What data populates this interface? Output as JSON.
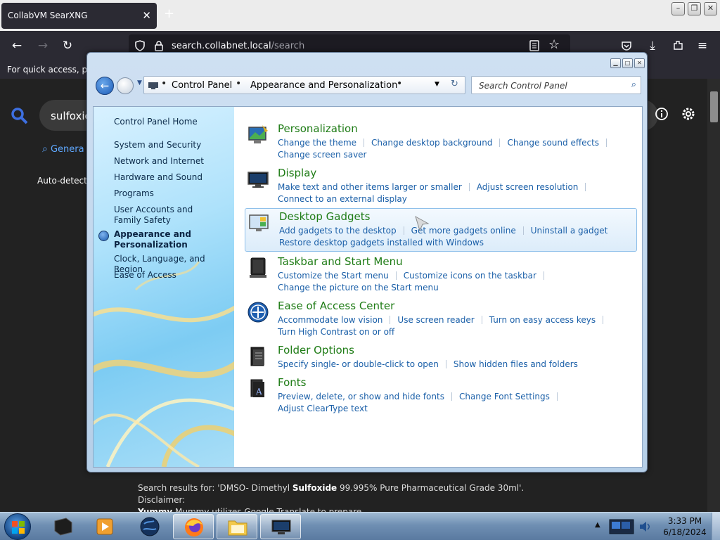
{
  "browser": {
    "tab_title": "CollabVM SearXNG",
    "tab_close": "✕",
    "new_tab": "+",
    "url_domain": "search.collabnet.local",
    "url_path": "/search",
    "bookmarks_text": "For quick access, plac",
    "search_query": "sulfoxic",
    "tab_general": "Genera",
    "autodetect": "Auto-detect",
    "snippet_prefix": "Search results for: 'DMSO- Dimethyl ",
    "snippet_bold1": "Sulfoxide",
    "snippet_mid": " 99.995% Pure Pharmaceutical Grade 30ml'. Disclaimer:",
    "snippet_bold2": "Yummy",
    "snippet_end": " Mummy utilizes Google Translate to prepare ..."
  },
  "control_panel": {
    "breadcrumb": [
      "Control Panel",
      "Appearance and Personalization"
    ],
    "search_placeholder": "Search Control Panel",
    "nav": {
      "home": "Control Panel Home",
      "items": [
        "System and Security",
        "Network and Internet",
        "Hardware and Sound",
        "Programs",
        "User Accounts and Family Safety",
        "Appearance and Personalization",
        "Clock, Language, and Region",
        "Ease of Access"
      ],
      "current_index": 5
    },
    "categories": [
      {
        "title": "Personalization",
        "icon": "personalization-icon",
        "links": [
          "Change the theme",
          "Change desktop background",
          "Change sound effects",
          "Change screen saver"
        ]
      },
      {
        "title": "Display",
        "icon": "display-icon",
        "links": [
          "Make text and other items larger or smaller",
          "Adjust screen resolution",
          "Connect to an external display"
        ]
      },
      {
        "title": "Desktop Gadgets",
        "icon": "desktop-gadgets-icon",
        "links": [
          "Add gadgets to the desktop",
          "Get more gadgets online",
          "Uninstall a gadget",
          "Restore desktop gadgets installed with Windows"
        ]
      },
      {
        "title": "Taskbar and Start Menu",
        "icon": "taskbar-icon",
        "links": [
          "Customize the Start menu",
          "Customize icons on the taskbar",
          "Change the picture on the Start menu"
        ]
      },
      {
        "title": "Ease of Access Center",
        "icon": "ease-of-access-icon",
        "links": [
          "Accommodate low vision",
          "Use screen reader",
          "Turn on easy access keys",
          "Turn High Contrast on or off"
        ]
      },
      {
        "title": "Folder Options",
        "icon": "folder-options-icon",
        "links": [
          "Specify single- or double-click to open",
          "Show hidden files and folders"
        ]
      },
      {
        "title": "Fonts",
        "icon": "fonts-icon",
        "links": [
          "Preview, delete, or show and hide fonts",
          "Change Font Settings",
          "Adjust ClearType text"
        ]
      }
    ]
  },
  "taskbar": {
    "time": "3:33 PM",
    "date": "6/18/2024",
    "items": [
      "terminal",
      "media-player",
      "globe",
      "firefox",
      "explorer",
      "control-panel"
    ]
  },
  "colors": {
    "link_blue": "#1a5fa8",
    "category_green": "#1f7c16",
    "browser_dark": "#1c1b22"
  }
}
